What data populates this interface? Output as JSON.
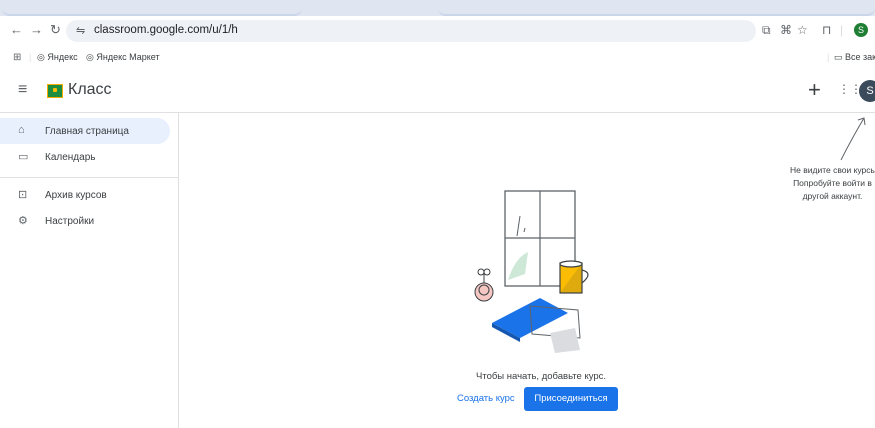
{
  "browser": {
    "url": "classroom.google.com/u/1/h",
    "profile_initial": "S",
    "bookmarks": [
      "Яндекс",
      "Яндекс Маркет"
    ],
    "all_bookmarks": "Все заклад"
  },
  "app": {
    "title": "Класс",
    "avatar_initial": "S"
  },
  "sidebar": {
    "items": [
      {
        "label": "Главная страница",
        "icon": "home-icon"
      },
      {
        "label": "Календарь",
        "icon": "calendar-icon"
      },
      {
        "label": "Архив курсов",
        "icon": "archive-icon"
      },
      {
        "label": "Настройки",
        "icon": "gear-icon"
      }
    ]
  },
  "empty_state": {
    "message": "Чтобы начать, добавьте курс.",
    "create_label": "Создать курс",
    "join_label": "Присоединиться"
  },
  "hint": {
    "line1": "Не видите свои курсы?",
    "line2": "Попробуйте войти в",
    "line3": "другой аккаунт."
  },
  "colors": {
    "accent": "#1a73e8",
    "active_nav": "#e8f0fe",
    "logo_green": "#1e8e3e",
    "logo_yellow": "#fbbc04"
  }
}
